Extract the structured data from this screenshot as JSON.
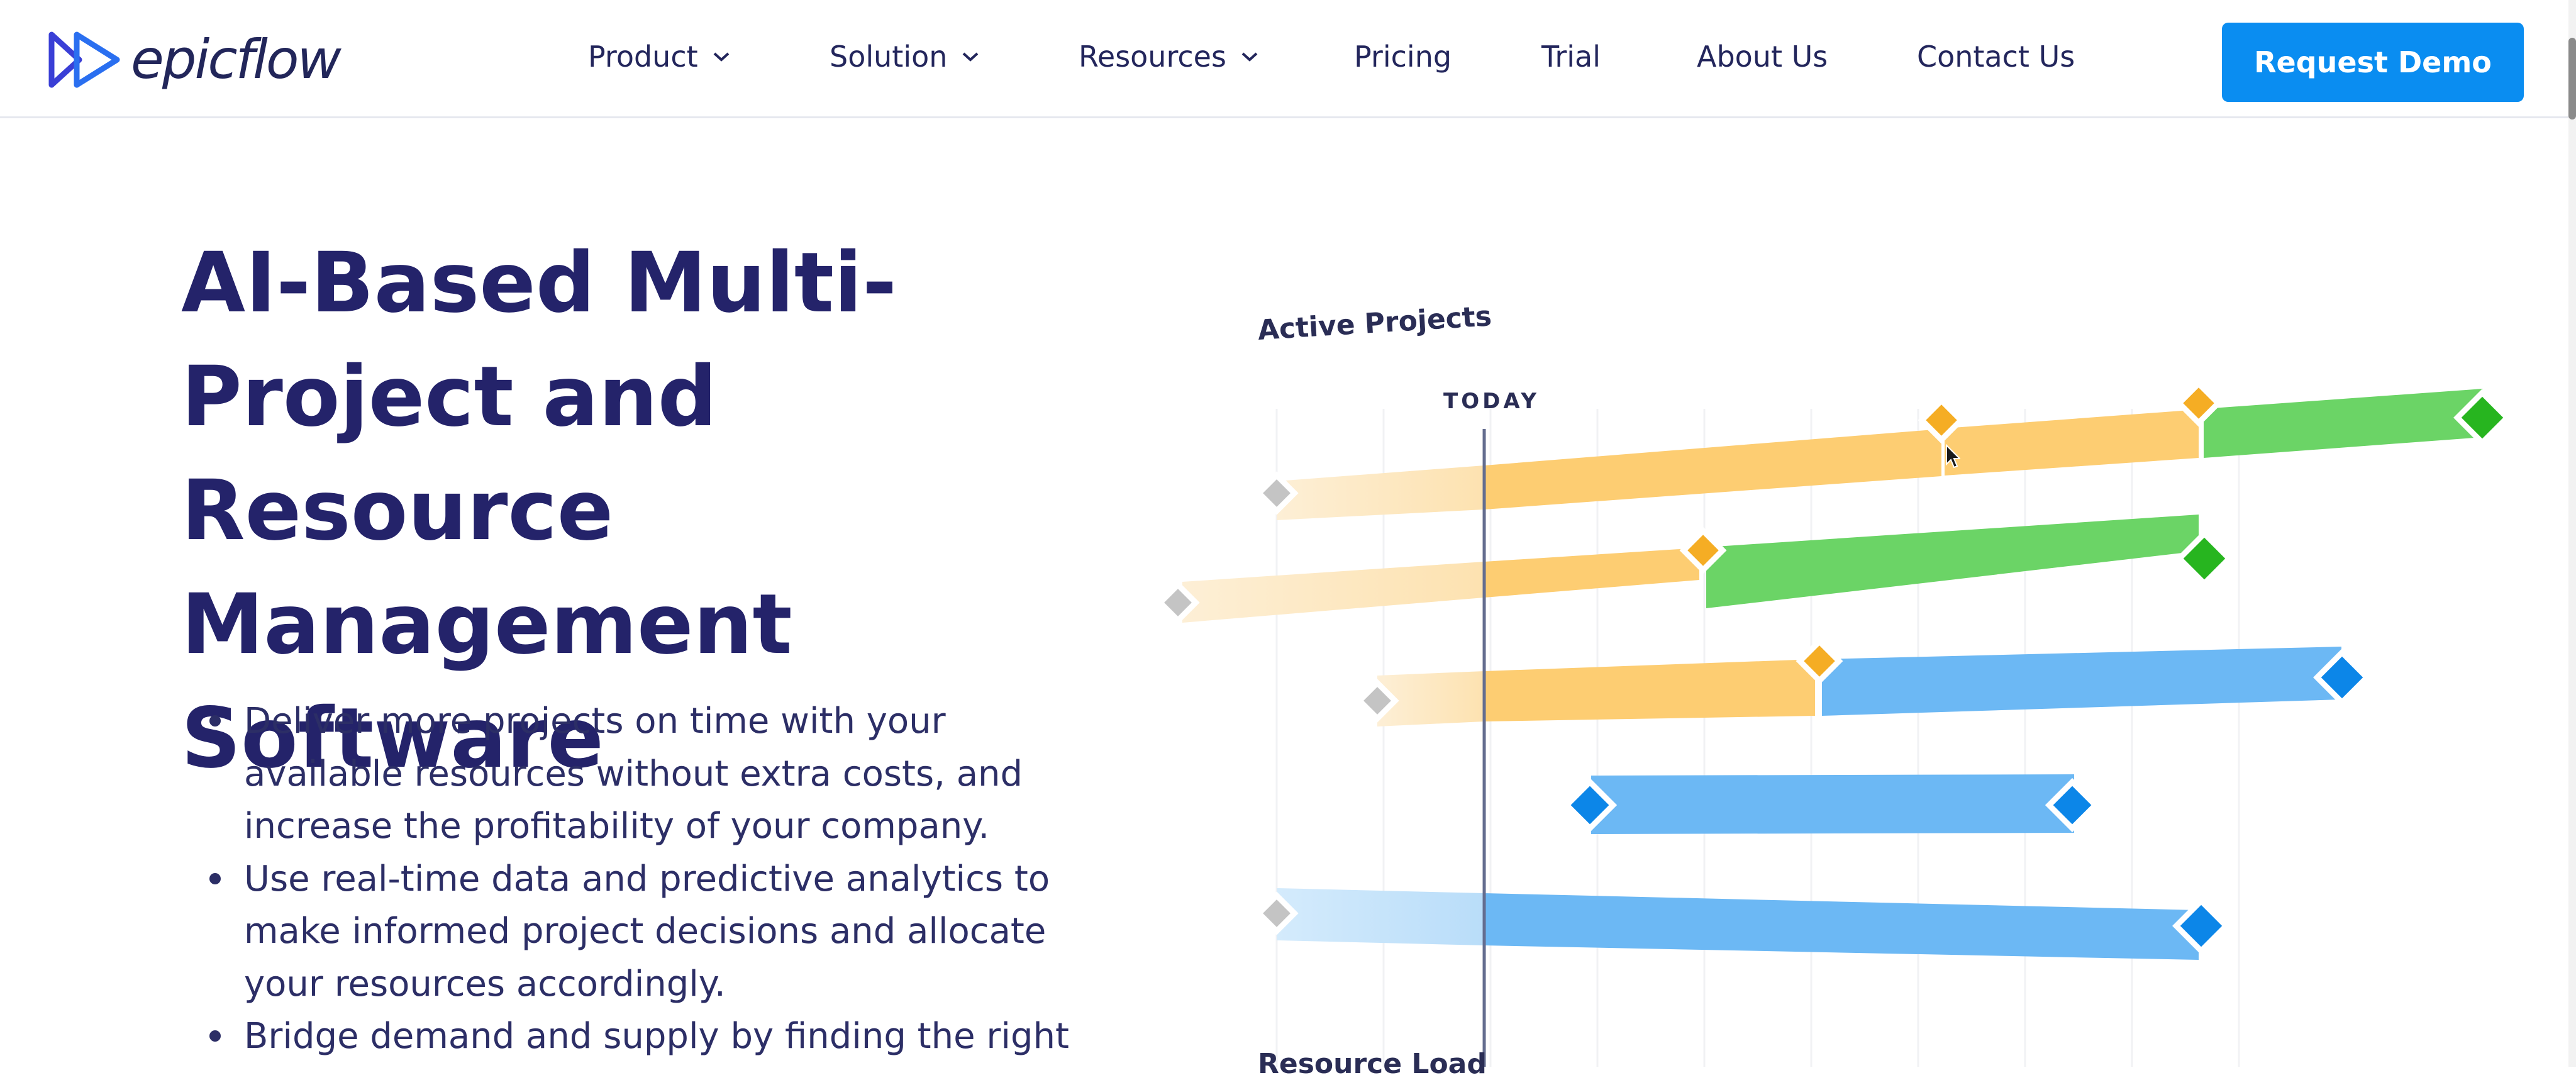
{
  "brand": {
    "name": "epicflow"
  },
  "nav": {
    "items": [
      {
        "label": "Product",
        "has_dropdown": true
      },
      {
        "label": "Solution",
        "has_dropdown": true
      },
      {
        "label": "Resources",
        "has_dropdown": true
      },
      {
        "label": "Pricing",
        "has_dropdown": false
      },
      {
        "label": "Trial",
        "has_dropdown": false
      },
      {
        "label": "About Us",
        "has_dropdown": false
      },
      {
        "label": "Contact Us",
        "has_dropdown": false
      }
    ],
    "cta_label": "Request Demo"
  },
  "hero": {
    "title_lines": [
      "AI-Based Multi-",
      "Project and Resource",
      "Management",
      "Software"
    ],
    "bullets": [
      "Deliver more projects on time with your available resources without extra costs, and increase the profitability of your company.",
      "Use real-time data and predictive analytics to make informed project decisions and allocate your resources accordingly.",
      "Bridge demand and supply by finding the right"
    ]
  },
  "illustration": {
    "title": "Active Projects",
    "today_label": "TODAY",
    "bottom_label": "Resource Load",
    "colors": {
      "pale": "#fbe7c0",
      "orange": "#fdcd72",
      "orange_milestone": "#f5ad24",
      "green": "#6bd466",
      "green_milestone": "#27b51f",
      "blue": "#6cb8f4",
      "blue_pale": "#c2e2fb",
      "blue_milestone": "#0c86e8",
      "grey_milestone": "#c4c4c4",
      "today_line": "#646d8f"
    }
  },
  "colors": {
    "accent": "#0a8df1",
    "heading": "#24236a",
    "text": "#2c2e66"
  }
}
